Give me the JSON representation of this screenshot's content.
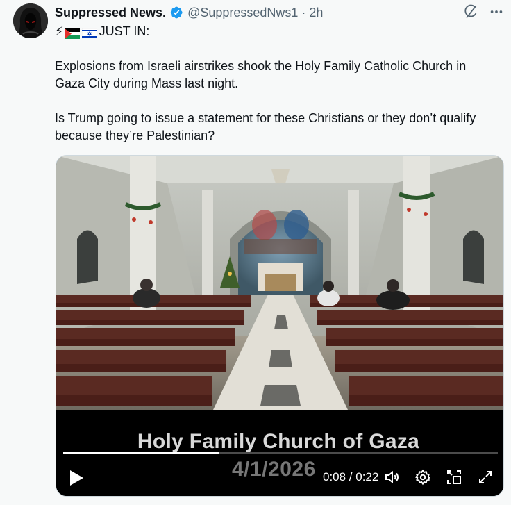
{
  "author": {
    "name": "Suppressed News.",
    "handle": "@SuppressedNws1",
    "separator": "·",
    "time": "2h",
    "verified": true
  },
  "icons": {
    "top_right": [
      "grok-icon",
      "more-icon"
    ],
    "badge": "verified-badge-icon",
    "flags": [
      "palestine-flag-icon",
      "israel-flag-icon"
    ],
    "bolt": "⚡"
  },
  "tweet": {
    "line1_text": "JUST IN:",
    "paragraph2": "Explosions from Israeli airstrikes shook the Holy Family Catholic Church in Gaza City during Mass last night.",
    "paragraph3": "Is Trump going to issue a statement for these Christians or they don’t qualify because they’re Palestinian?"
  },
  "video": {
    "caption_title": "Holy Family Church of Gaza",
    "caption_date": "4/1/2026",
    "time_readout": "0:08 / 0:22",
    "progress_fraction": 0.36,
    "controls": [
      "play-icon",
      "volume-icon",
      "settings-gear-icon",
      "picture-in-picture-icon",
      "fullscreen-icon"
    ]
  },
  "colors": {
    "verified_blue": "#1d9bf0",
    "secondary_text": "#536471",
    "background": "#f7f9f9"
  }
}
